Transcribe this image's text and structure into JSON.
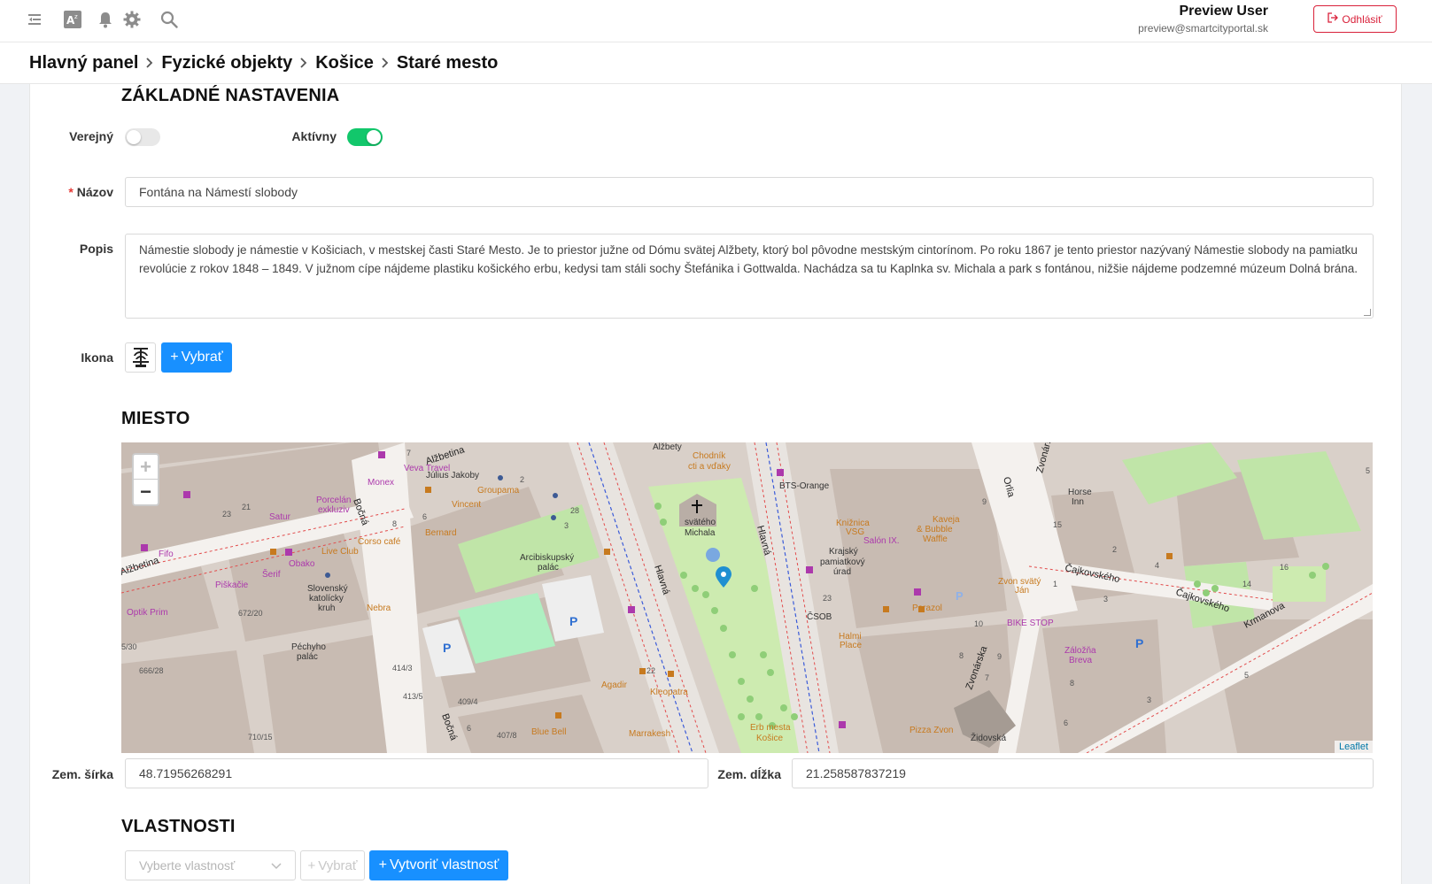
{
  "topbar": {
    "icons": [
      "menu-fold-icon",
      "translate-icon",
      "bell-icon",
      "gear-icon",
      "search-icon"
    ],
    "user_name": "Preview User",
    "user_email": "preview@smartcityportal.sk",
    "logout_label": "Odhlásiť"
  },
  "breadcrumb": [
    "Hlavný panel",
    "Fyzické objekty",
    "Košice",
    "Staré mesto"
  ],
  "basic": {
    "section_title": "ZÁKLADNÉ NASTAVENIA",
    "public_label": "Verejný",
    "public_on": false,
    "active_label": "Aktívny",
    "active_on": true,
    "name_label": "Názov",
    "name_required_mark": "*",
    "name_value": "Fontána na Námestí slobody",
    "description_label": "Popis",
    "description_value": "Námestie slobody je námestie v Košiciach, v mestskej časti Staré Mesto. Je to priestor južne od Dómu svätej Alžbety, ktorý bol pôvodne mestským cintorínom. Po roku 1867 je tento priestor nazývaný Námestie slobody na pamiatku revolúcie z rokov 1848 – 1849. V južnom cípe nájdeme plastiku košického erbu, kedysi tam stáli sochy Štefánika i Gottwalda. Nachádza sa tu Kaplnka sv. Michala a park s fontánou, nižšie nájdeme podzemné múzeum Dolná brána.",
    "icon_label": "Ikona",
    "icon_name": "fountain-icon",
    "choose_label": "Vybrať"
  },
  "location": {
    "section_title": "MIESTO",
    "map": {
      "zoom_in": "+",
      "zoom_out": "−",
      "attribution": "Leaflet",
      "labels": {
        "streets": [
          "Alžbetina",
          "Alžbetina",
          "Hlavná",
          "Hlavná",
          "Bočná",
          "Bočná",
          "Orlia",
          "Zvonárska",
          "Zvonárska",
          "Čajkovského",
          "Čajkovského",
          "Krmanova"
        ],
        "places": [
          "Alžbety",
          "Chodník cti a vďaky",
          "svätého Michala",
          "BTS-Orange",
          "Knižnica VSG",
          "Salón IX.",
          "Krajský pamiatkový úrad",
          "Kaveja & Bubble Waffle",
          "Horse Inn",
          "Zvon svätý Ján",
          "BIKE STOP",
          "Záložňa Breva",
          "Parazol",
          "ČSOB",
          "Halmi Place",
          "Pizza Zvon",
          "Židovská",
          "Erb mesta Košice",
          "Kleopatra",
          "Marrakesh",
          "Blue Bell",
          "Agadir",
          "Nebra",
          "Arcibiskupský palác",
          "Groupama",
          "Vincent",
          "Bernard",
          "Corso café",
          "Live Club",
          "Obako",
          "Šerif",
          "Piškačie",
          "Porcelán exkluziv",
          "Satur",
          "Fifo",
          "Optik Prim",
          "Monex",
          "Veva Travel",
          "Július Jakoby",
          "Slovenský katolícky kruh",
          "Péchyho palác"
        ],
        "numbers": [
          "7",
          "2",
          "21",
          "23",
          "28",
          "6",
          "8",
          "3",
          "672/20",
          "414/3",
          "413/5",
          "409/4",
          "407/8",
          "710/15",
          "666/28",
          "5/30",
          "23",
          "10",
          "8",
          "9",
          "15",
          "2",
          "1",
          "3",
          "4",
          "16",
          "14",
          "5",
          "7",
          "8",
          "6",
          "22",
          "5",
          "9",
          "3",
          "6"
        ]
      }
    },
    "lat_label": "Zem. šírka",
    "lat_value": "48.71956268291",
    "lng_label": "Zem. dĺžka",
    "lng_value": "21.258587837219"
  },
  "properties": {
    "section_title": "VLASTNOSTI",
    "select_placeholder": "Vyberte vlastnosť",
    "choose_label": "Vybrať",
    "create_label": "Vytvoriť vlastnosť"
  }
}
